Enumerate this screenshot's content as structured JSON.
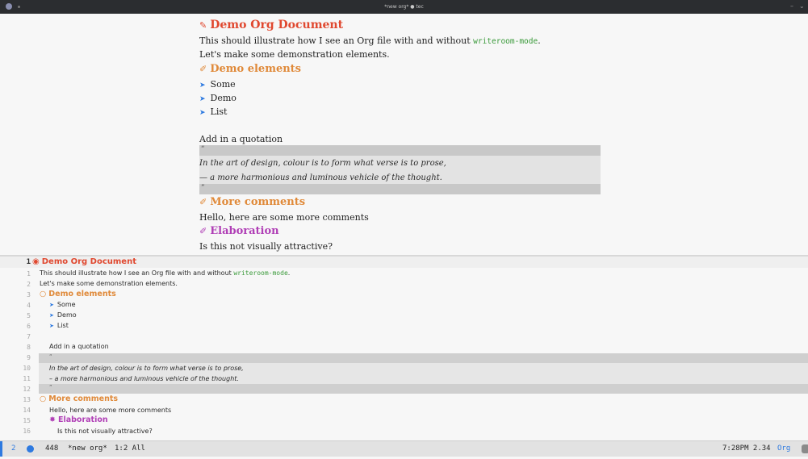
{
  "window": {
    "title": "*new org* ● tec"
  },
  "writeroom": {
    "title": "Demo Org Document",
    "intro_prefix": "This should illustrate how I see an Org file with and without ",
    "intro_code": "writeroom-mode",
    "intro_suffix": ".",
    "line2": "Let's make some demonstration elements.",
    "h_elements": "Demo elements",
    "list": [
      "Some",
      "Demo",
      "List"
    ],
    "quote_intro": "Add in a quotation",
    "quote_open": "“",
    "quote_lines": [
      "In the art of design, colour is to form what verse is to prose,",
      "— a more harmonious and luminous vehicle of the thought."
    ],
    "quote_close": "”",
    "h_more": "More comments",
    "more_text": "Hello, here are some more comments",
    "h_elab": "Elaboration",
    "elab_text": "Is this not visually attractive?"
  },
  "editor": {
    "line_numbers": [
      "1",
      "1",
      "2",
      "3",
      "4",
      "5",
      "6",
      "7",
      "8",
      "9",
      "10",
      "11",
      "12",
      "13",
      "14",
      "15",
      "16"
    ],
    "title": "Demo Org Document",
    "intro_prefix": "This should illustrate how I see an Org file with and without ",
    "intro_code": "writeroom-mode",
    "intro_suffix": ".",
    "line2": "Let's make some demonstration elements.",
    "h_elements": "Demo elements",
    "list": [
      "Some",
      "Demo",
      "List"
    ],
    "quote_intro": "Add in a quotation",
    "quote_open": "“",
    "quote_lines": [
      "In the art of design, colour is to form what verse is to prose,",
      "– a more harmonious and luminous vehicle of the thought."
    ],
    "quote_close": "”",
    "h_more": "More comments",
    "more_text": "Hello, here are some more comments",
    "h_elab": "Elaboration",
    "elab_text": "Is this not visually attractive?"
  },
  "modeline": {
    "workspace": "2",
    "size": "448",
    "buffer": "*new org*",
    "position": "1:2 All",
    "time": "7:28PM 2.34",
    "mode": "Org"
  },
  "colors": {
    "h1": "#e0482f",
    "h2": "#e08a3a",
    "h3": "#b03fb6",
    "code": "#3a9a3a",
    "bullet": "#2e7ae0",
    "accent": "#2e7ae0"
  },
  "icons": {
    "h1_icon": "✎",
    "h2_icon": "✐",
    "h3_icon": "✐",
    "editor_h1_icon": "◉",
    "editor_h2_icon": "○",
    "editor_h3_icon": "✸",
    "bullet": "➤"
  }
}
